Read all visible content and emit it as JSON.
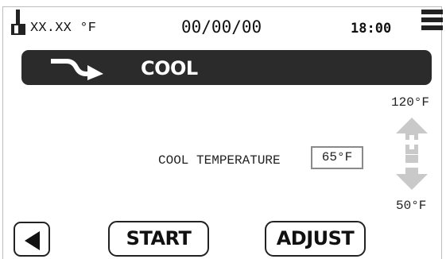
{
  "status_bar": {
    "probe_icon": "probe-thermometer-icon",
    "probe_temperature": "XX.XX °F",
    "date": "00/00/00",
    "time": "18:00",
    "menu_icon": "hamburger-menu-icon"
  },
  "mode": {
    "icon": "curved-arrow-icon",
    "label": "COOL"
  },
  "range": {
    "max": "120°F",
    "min": "50°F",
    "increase_icon": "plus-arrow-up-icon",
    "decrease_icon": "minus-arrow-down-icon",
    "arrow_color": "#c9c9c9"
  },
  "setpoint": {
    "label": "COOL TEMPERATURE",
    "value": "65°F"
  },
  "buttons": {
    "back_icon": "back-triangle-icon",
    "start": "START",
    "adjust": "ADJUST"
  },
  "colors": {
    "banner": "#2b2b2b",
    "text": "#111111"
  }
}
